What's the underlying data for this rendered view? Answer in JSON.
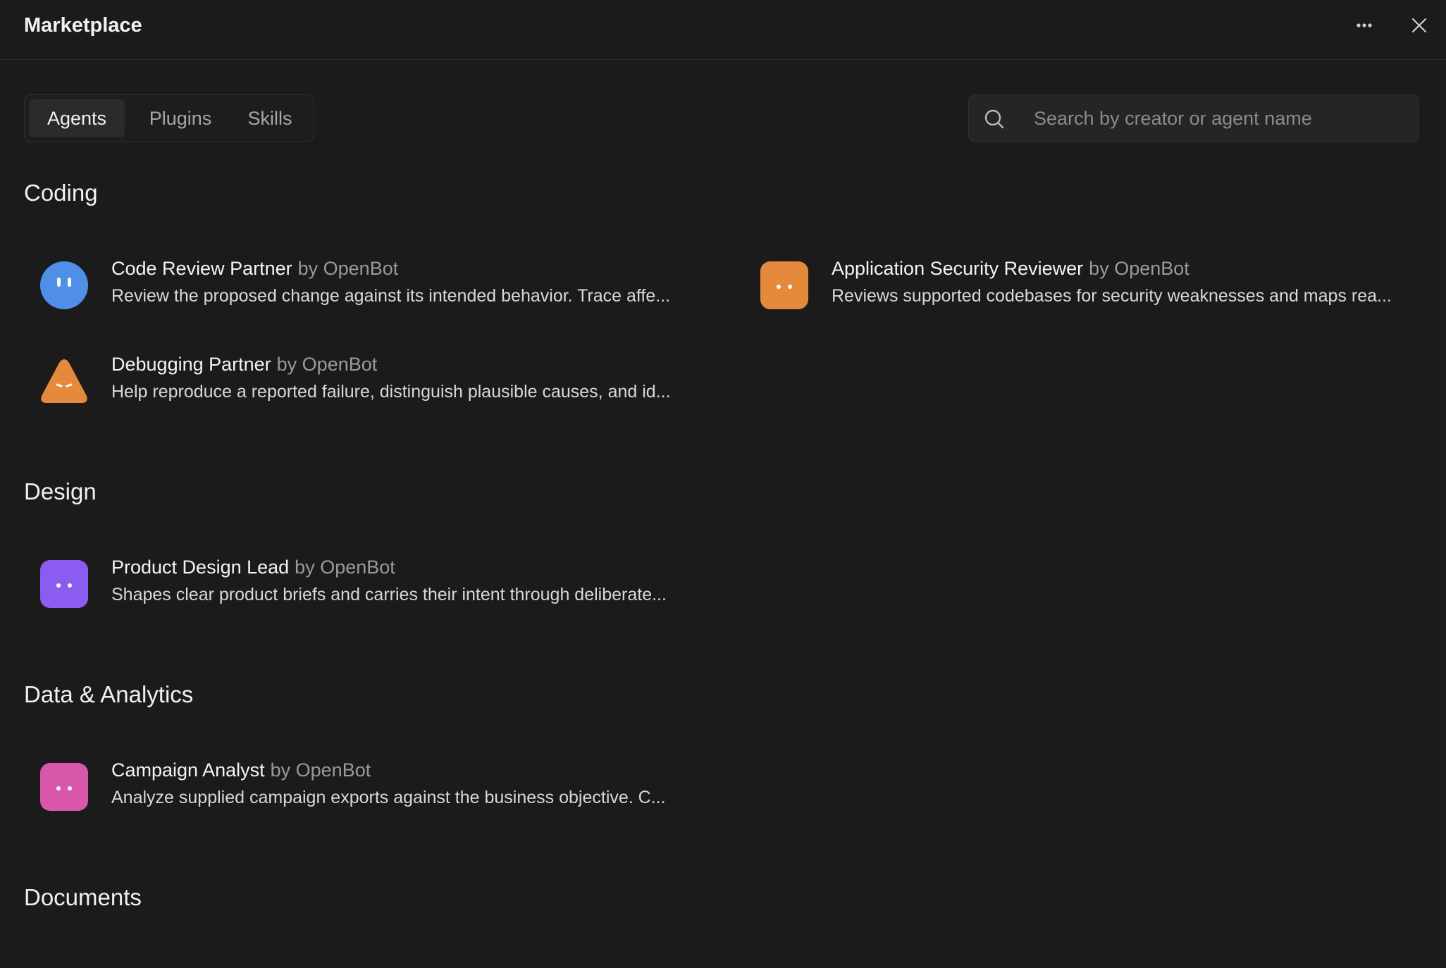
{
  "header": {
    "title": "Marketplace"
  },
  "tabs": [
    {
      "label": "Agents",
      "active": true
    },
    {
      "label": "Plugins",
      "active": false
    },
    {
      "label": "Skills",
      "active": false
    }
  ],
  "search": {
    "placeholder": "Search by creator or agent name",
    "value": ""
  },
  "sections": [
    {
      "title": "Coding",
      "agents": [
        {
          "name": "Code Review Partner",
          "by": "by OpenBot",
          "description": "Review the proposed change against its intended behavior. Trace affe...",
          "avatar_shape": "circle",
          "avatar_color": "#4f8fe8"
        },
        {
          "name": "Application Security Reviewer",
          "by": "by OpenBot",
          "description": "Reviews supported codebases for security weaknesses and maps rea...",
          "avatar_shape": "rounded-square",
          "avatar_color": "#e58a3c"
        },
        {
          "name": "Debugging Partner",
          "by": "by OpenBot",
          "description": "Help reproduce a reported failure, distinguish plausible causes, and id...",
          "avatar_shape": "triangle",
          "avatar_color": "#e58a3c"
        }
      ]
    },
    {
      "title": "Design",
      "agents": [
        {
          "name": "Product Design Lead",
          "by": "by OpenBot",
          "description": "Shapes clear product briefs and carries their intent through deliberate...",
          "avatar_shape": "rounded-square",
          "avatar_color": "#8a5cf0"
        }
      ]
    },
    {
      "title": "Data & Analytics",
      "agents": [
        {
          "name": "Campaign Analyst",
          "by": "by OpenBot",
          "description": "Analyze supplied campaign exports against the business objective. C...",
          "avatar_shape": "rounded-square",
          "avatar_color": "#d957ab"
        }
      ]
    },
    {
      "title": "Documents",
      "agents": []
    }
  ],
  "icons": {
    "more": "more-horizontal-icon",
    "close": "close-icon",
    "search": "search-icon"
  }
}
